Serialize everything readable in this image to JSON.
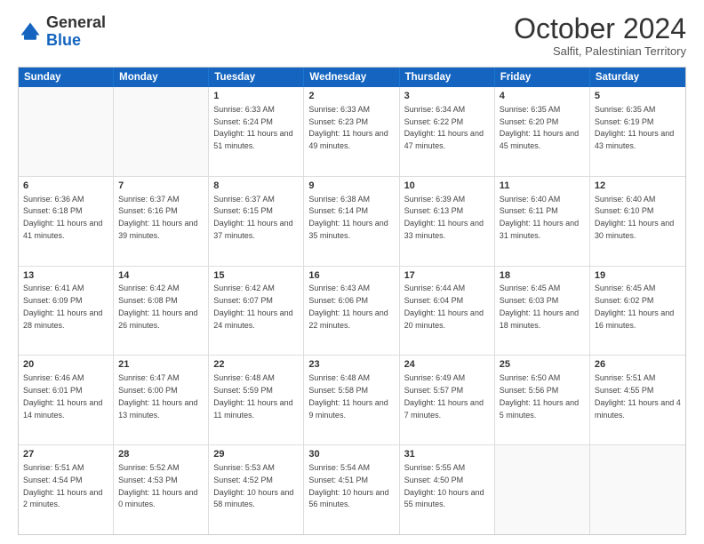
{
  "logo": {
    "line1": "General",
    "line2": "Blue"
  },
  "title": "October 2024",
  "subtitle": "Salfit, Palestinian Territory",
  "days": [
    "Sunday",
    "Monday",
    "Tuesday",
    "Wednesday",
    "Thursday",
    "Friday",
    "Saturday"
  ],
  "rows": [
    [
      {
        "day": "",
        "info": ""
      },
      {
        "day": "",
        "info": ""
      },
      {
        "day": "1",
        "info": "Sunrise: 6:33 AM\nSunset: 6:24 PM\nDaylight: 11 hours and 51 minutes."
      },
      {
        "day": "2",
        "info": "Sunrise: 6:33 AM\nSunset: 6:23 PM\nDaylight: 11 hours and 49 minutes."
      },
      {
        "day": "3",
        "info": "Sunrise: 6:34 AM\nSunset: 6:22 PM\nDaylight: 11 hours and 47 minutes."
      },
      {
        "day": "4",
        "info": "Sunrise: 6:35 AM\nSunset: 6:20 PM\nDaylight: 11 hours and 45 minutes."
      },
      {
        "day": "5",
        "info": "Sunrise: 6:35 AM\nSunset: 6:19 PM\nDaylight: 11 hours and 43 minutes."
      }
    ],
    [
      {
        "day": "6",
        "info": "Sunrise: 6:36 AM\nSunset: 6:18 PM\nDaylight: 11 hours and 41 minutes."
      },
      {
        "day": "7",
        "info": "Sunrise: 6:37 AM\nSunset: 6:16 PM\nDaylight: 11 hours and 39 minutes."
      },
      {
        "day": "8",
        "info": "Sunrise: 6:37 AM\nSunset: 6:15 PM\nDaylight: 11 hours and 37 minutes."
      },
      {
        "day": "9",
        "info": "Sunrise: 6:38 AM\nSunset: 6:14 PM\nDaylight: 11 hours and 35 minutes."
      },
      {
        "day": "10",
        "info": "Sunrise: 6:39 AM\nSunset: 6:13 PM\nDaylight: 11 hours and 33 minutes."
      },
      {
        "day": "11",
        "info": "Sunrise: 6:40 AM\nSunset: 6:11 PM\nDaylight: 11 hours and 31 minutes."
      },
      {
        "day": "12",
        "info": "Sunrise: 6:40 AM\nSunset: 6:10 PM\nDaylight: 11 hours and 30 minutes."
      }
    ],
    [
      {
        "day": "13",
        "info": "Sunrise: 6:41 AM\nSunset: 6:09 PM\nDaylight: 11 hours and 28 minutes."
      },
      {
        "day": "14",
        "info": "Sunrise: 6:42 AM\nSunset: 6:08 PM\nDaylight: 11 hours and 26 minutes."
      },
      {
        "day": "15",
        "info": "Sunrise: 6:42 AM\nSunset: 6:07 PM\nDaylight: 11 hours and 24 minutes."
      },
      {
        "day": "16",
        "info": "Sunrise: 6:43 AM\nSunset: 6:06 PM\nDaylight: 11 hours and 22 minutes."
      },
      {
        "day": "17",
        "info": "Sunrise: 6:44 AM\nSunset: 6:04 PM\nDaylight: 11 hours and 20 minutes."
      },
      {
        "day": "18",
        "info": "Sunrise: 6:45 AM\nSunset: 6:03 PM\nDaylight: 11 hours and 18 minutes."
      },
      {
        "day": "19",
        "info": "Sunrise: 6:45 AM\nSunset: 6:02 PM\nDaylight: 11 hours and 16 minutes."
      }
    ],
    [
      {
        "day": "20",
        "info": "Sunrise: 6:46 AM\nSunset: 6:01 PM\nDaylight: 11 hours and 14 minutes."
      },
      {
        "day": "21",
        "info": "Sunrise: 6:47 AM\nSunset: 6:00 PM\nDaylight: 11 hours and 13 minutes."
      },
      {
        "day": "22",
        "info": "Sunrise: 6:48 AM\nSunset: 5:59 PM\nDaylight: 11 hours and 11 minutes."
      },
      {
        "day": "23",
        "info": "Sunrise: 6:48 AM\nSunset: 5:58 PM\nDaylight: 11 hours and 9 minutes."
      },
      {
        "day": "24",
        "info": "Sunrise: 6:49 AM\nSunset: 5:57 PM\nDaylight: 11 hours and 7 minutes."
      },
      {
        "day": "25",
        "info": "Sunrise: 6:50 AM\nSunset: 5:56 PM\nDaylight: 11 hours and 5 minutes."
      },
      {
        "day": "26",
        "info": "Sunrise: 5:51 AM\nSunset: 4:55 PM\nDaylight: 11 hours and 4 minutes."
      }
    ],
    [
      {
        "day": "27",
        "info": "Sunrise: 5:51 AM\nSunset: 4:54 PM\nDaylight: 11 hours and 2 minutes."
      },
      {
        "day": "28",
        "info": "Sunrise: 5:52 AM\nSunset: 4:53 PM\nDaylight: 11 hours and 0 minutes."
      },
      {
        "day": "29",
        "info": "Sunrise: 5:53 AM\nSunset: 4:52 PM\nDaylight: 10 hours and 58 minutes."
      },
      {
        "day": "30",
        "info": "Sunrise: 5:54 AM\nSunset: 4:51 PM\nDaylight: 10 hours and 56 minutes."
      },
      {
        "day": "31",
        "info": "Sunrise: 5:55 AM\nSunset: 4:50 PM\nDaylight: 10 hours and 55 minutes."
      },
      {
        "day": "",
        "info": ""
      },
      {
        "day": "",
        "info": ""
      }
    ]
  ]
}
